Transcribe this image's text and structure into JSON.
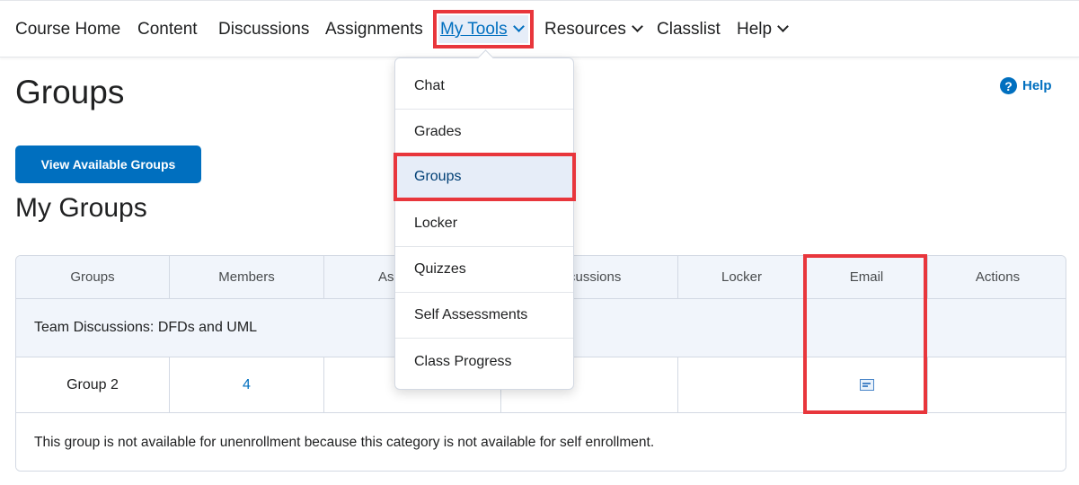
{
  "nav": {
    "items": [
      {
        "label": "Course Home"
      },
      {
        "label": "Content"
      },
      {
        "label": "Discussions"
      },
      {
        "label": "Assignments"
      },
      {
        "label": "My Tools"
      },
      {
        "label": "Resources"
      },
      {
        "label": "Classlist"
      },
      {
        "label": "Help"
      }
    ]
  },
  "page": {
    "title": "Groups",
    "help_label": "Help",
    "help_icon": "?",
    "view_groups_button": "View Available Groups",
    "section_title": "My Groups"
  },
  "dropdown": {
    "items": [
      {
        "label": "Chat"
      },
      {
        "label": "Grades"
      },
      {
        "label": "Groups"
      },
      {
        "label": "Locker"
      },
      {
        "label": "Quizzes"
      },
      {
        "label": "Self Assessments"
      },
      {
        "label": "Class Progress"
      }
    ]
  },
  "table": {
    "headers": [
      "Groups",
      "Members",
      "Ass",
      "cussions",
      "Locker",
      "Email",
      "Actions"
    ],
    "category": "Team Discussions: DFDs and UML",
    "row": {
      "group": "Group 2",
      "members": "4"
    },
    "note": "This group is not available for unenrollment because this category is not available for self enrollment."
  },
  "colors": {
    "accent": "#006fbf",
    "highlight": "#e8363c",
    "header_bg": "#f1f5fb"
  }
}
